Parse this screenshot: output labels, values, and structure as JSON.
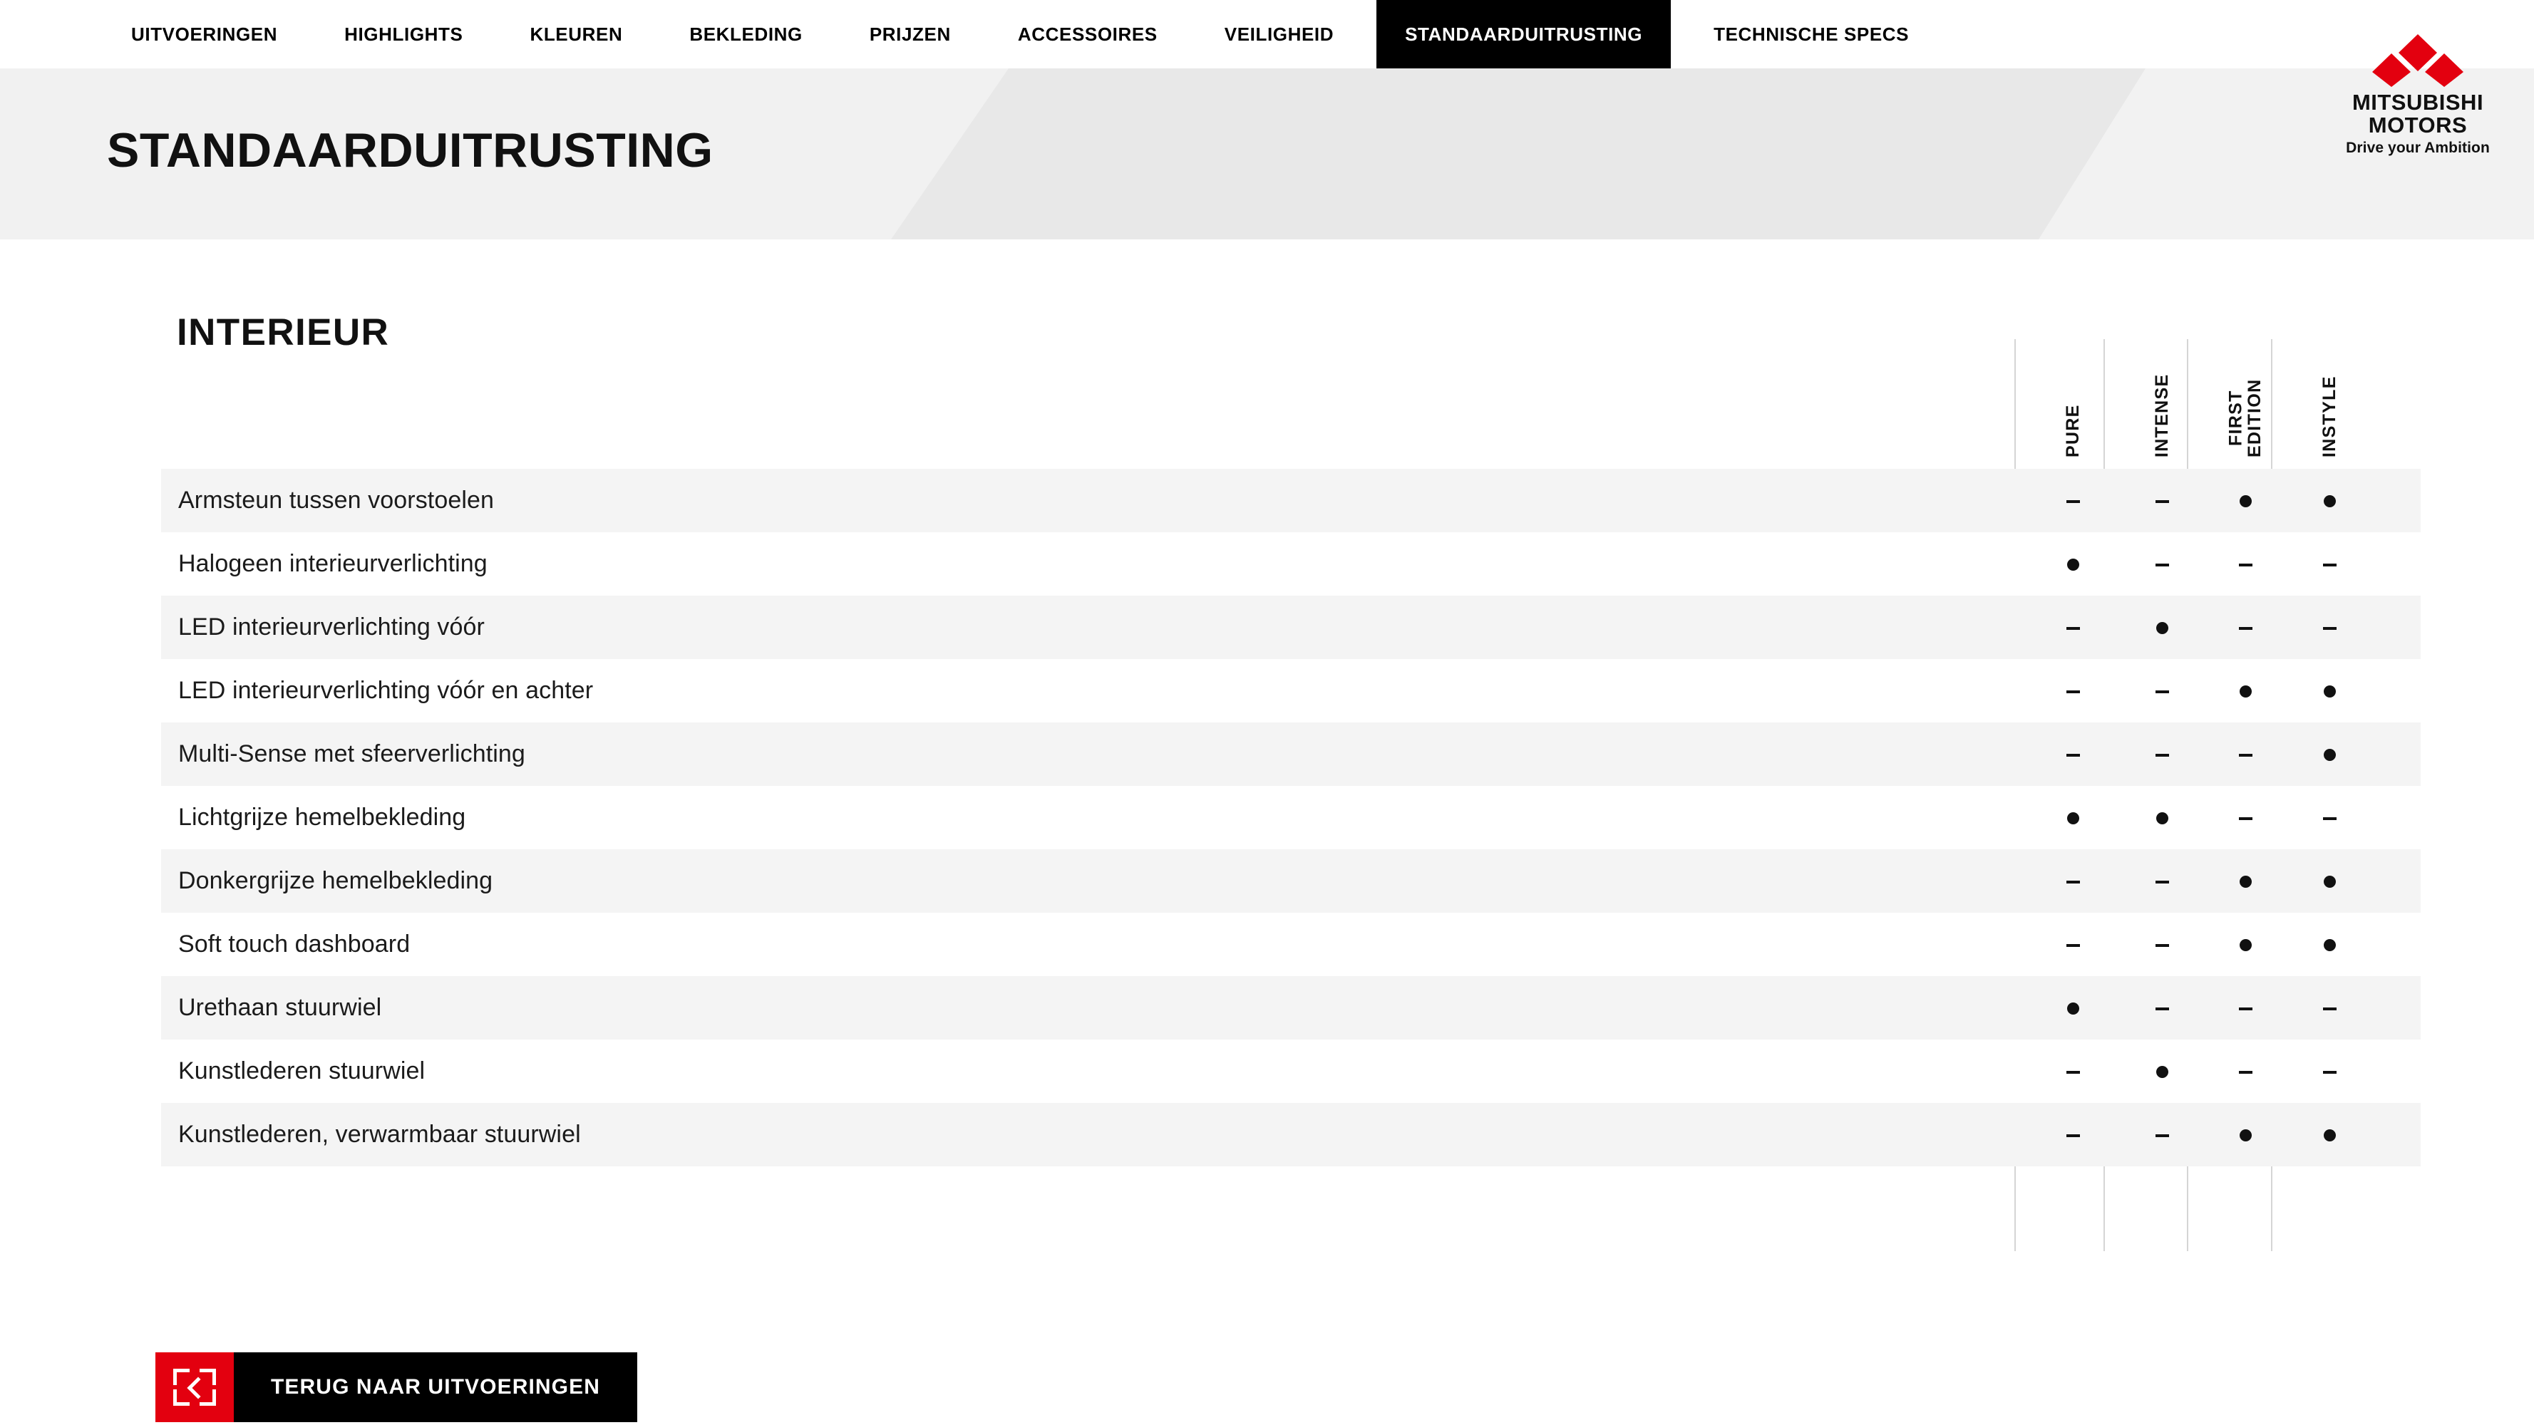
{
  "nav": {
    "items": [
      {
        "label": "UITVOERINGEN",
        "active": false
      },
      {
        "label": "HIGHLIGHTS",
        "active": false
      },
      {
        "label": "KLEUREN",
        "active": false
      },
      {
        "label": "BEKLEDING",
        "active": false
      },
      {
        "label": "PRIJZEN",
        "active": false
      },
      {
        "label": "ACCESSOIRES",
        "active": false
      },
      {
        "label": "VEILIGHEID",
        "active": false
      },
      {
        "label": "STANDAARDUITRUSTING",
        "active": true
      },
      {
        "label": "TECHNISCHE SPECS",
        "active": false
      }
    ]
  },
  "brand": {
    "name_line1": "MITSUBISHI",
    "name_line2": "MOTORS",
    "tagline": "Drive your Ambition",
    "accent_color": "#e3000f"
  },
  "header": {
    "title": "STANDAARDUITRUSTING"
  },
  "section": {
    "title": "INTERIEUR"
  },
  "table": {
    "columns": [
      "PURE",
      "INTENSE",
      "FIRST\nEDITION",
      "INSTYLE"
    ],
    "rows": [
      {
        "feature": "Armsteun tussen voorstoelen",
        "values": [
          "dash",
          "dash",
          "dot",
          "dot"
        ]
      },
      {
        "feature": "Halogeen interieurverlichting",
        "values": [
          "dot",
          "dash",
          "dash",
          "dash"
        ]
      },
      {
        "feature": "LED interieurverlichting vóór",
        "values": [
          "dash",
          "dot",
          "dash",
          "dash"
        ]
      },
      {
        "feature": "LED interieurverlichting vóór en achter",
        "values": [
          "dash",
          "dash",
          "dot",
          "dot"
        ]
      },
      {
        "feature": "Multi-Sense met sfeerverlichting",
        "values": [
          "dash",
          "dash",
          "dash",
          "dot"
        ]
      },
      {
        "feature": "Lichtgrijze hemelbekleding",
        "values": [
          "dot",
          "dot",
          "dash",
          "dash"
        ]
      },
      {
        "feature": "Donkergrijze hemelbekleding",
        "values": [
          "dash",
          "dash",
          "dot",
          "dot"
        ]
      },
      {
        "feature": "Soft touch dashboard",
        "values": [
          "dash",
          "dash",
          "dot",
          "dot"
        ]
      },
      {
        "feature": "Urethaan stuurwiel",
        "values": [
          "dot",
          "dash",
          "dash",
          "dash"
        ]
      },
      {
        "feature": "Kunstlederen stuurwiel",
        "values": [
          "dash",
          "dot",
          "dash",
          "dash"
        ]
      },
      {
        "feature": "Kunstlederen, verwarmbaar stuurwiel",
        "values": [
          "dash",
          "dash",
          "dot",
          "dot"
        ]
      }
    ]
  },
  "back_button": {
    "label": "TERUG NAAR UITVOERINGEN",
    "icon": "fullscreen-back-chevron-icon"
  }
}
